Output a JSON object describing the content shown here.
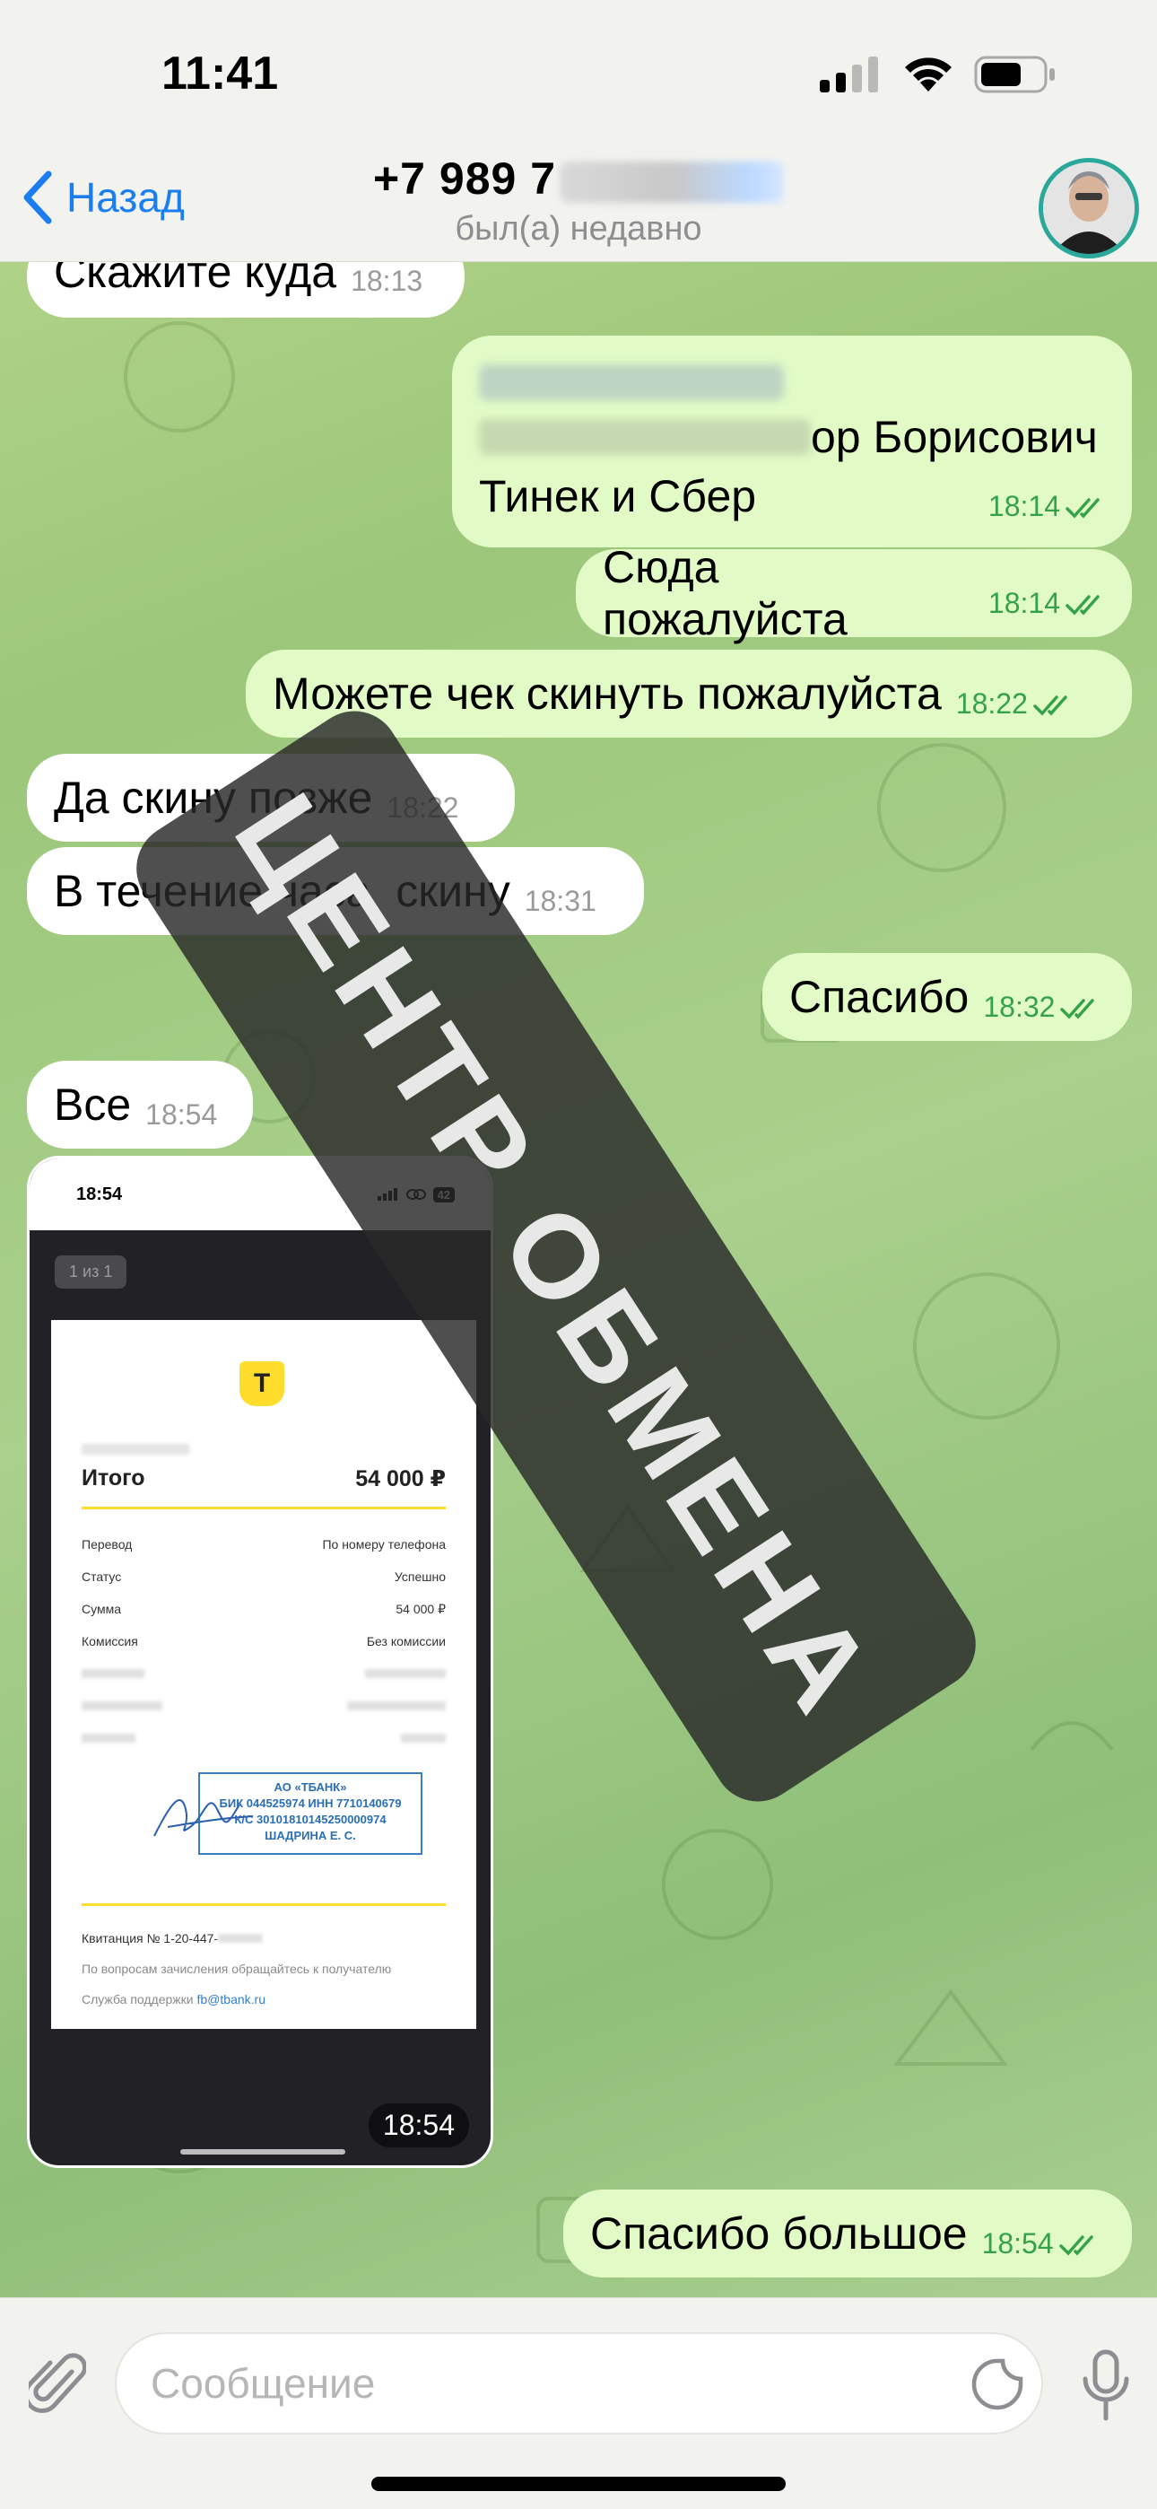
{
  "status_bar": {
    "time": "11:41"
  },
  "header": {
    "back_label": "Назад",
    "title": "+7 989 7",
    "subtitle": "был(а) недавно"
  },
  "messages": [
    {
      "direction": "in",
      "text": "Скажите куда",
      "time": "18:13"
    },
    {
      "direction": "out",
      "line2": "ор Борисович",
      "line3": "Тинек и Сбер",
      "time": "18:14",
      "read": true
    },
    {
      "direction": "out",
      "text": "Сюда пожалуйста",
      "time": "18:14",
      "read": true
    },
    {
      "direction": "out",
      "text": "Можете чек скинуть пожалуйста",
      "time": "18:22",
      "read": true
    },
    {
      "direction": "in",
      "text": "Да скину позже",
      "time": "18:22"
    },
    {
      "direction": "in",
      "text": "В течение часа  скину",
      "time": "18:31"
    },
    {
      "direction": "out",
      "text": "Спасибо",
      "time": "18:32",
      "read": true
    },
    {
      "direction": "in",
      "text": "Все",
      "time": "18:54"
    },
    {
      "direction": "out",
      "text": "Спасибо большое",
      "time": "18:54",
      "read": true
    }
  ],
  "photo": {
    "time": "18:54",
    "inner_status_time": "18:54",
    "inner_battery": "42",
    "pager": "1 из 1",
    "receipt": {
      "logo_letter": "Т",
      "total_label": "Итого",
      "total_value": "54 000 ₽",
      "rows": [
        {
          "label": "Перевод",
          "value": "По номеру телефона"
        },
        {
          "label": "Статус",
          "value": "Успешно"
        },
        {
          "label": "Сумма",
          "value": "54 000 ₽"
        },
        {
          "label": "Комиссия",
          "value": "Без комиссии"
        }
      ],
      "stamp": {
        "line1": "АО «ТБАНК»",
        "line2": "БИК 044525974 ИНН 7710140679",
        "line3": "К/С 30101810145250000974",
        "line4": "ШАДРИНА Е. С."
      },
      "receipt_label": "Квитанция  № 1-20-447-",
      "note": "По вопросам зачисления обращайтесь к получателю",
      "support_label": "Служба поддержки ",
      "support_email": "fb@tbank.ru"
    }
  },
  "watermark": "ЦЕНТР ОБМЕНА",
  "composer": {
    "placeholder": "Сообщение"
  },
  "colors": {
    "accent": "#1a7ef0",
    "outgoing": "#e2fbc6",
    "incoming": "#ffffff",
    "check": "#35a24a"
  }
}
